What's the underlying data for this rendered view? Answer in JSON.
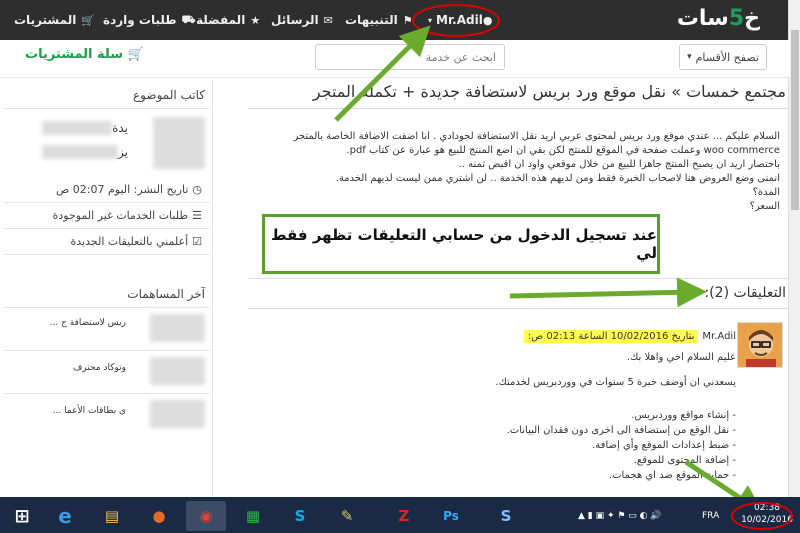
{
  "topbar": {
    "logo_text": "خ",
    "logo_num": "5",
    "logo_rest": "سات",
    "nav": [
      {
        "label": "Mr.Adil"
      },
      {
        "label": "التنبيهات"
      },
      {
        "label": "الرسائل"
      },
      {
        "label": "المفضلة"
      },
      {
        "label": "طلبات واردة"
      },
      {
        "label": "المشتريات"
      }
    ]
  },
  "subbar": {
    "browse_label": "تصفح الأقسام",
    "search_placeholder": "ابحث عن خدمة",
    "cart_label": "سلة المشتريات"
  },
  "post": {
    "title": "مجتمع خمسات » نقل موقع ورد بريس لاستضافة جديدة + تكملة المتجر",
    "lines": [
      "السلام عليكم ... عندي موقع ورد بريس لمحتوى عربي اريد نقل الاستضافة لجودادي . انا اضفت الاضافة الخاصة بالمتجر",
      "woo commerce وعملت صفحة في الموقع للمنتج لكن بقي ان اضع المنتج للبيع هو عبارة عن كتاب pdf.",
      "باختصار اريد ان يصبح المنتج جاهزا للبيع من خلال موقعي واود ان اقبض ثمنه ..",
      "انمنى وضع العروض هنا لاصحاب الخبرة فقط ومن لديهم هذه الخدمة .. لن اشتري ممن ليست لديهم الخدمة.",
      "المدة؟",
      "السعر؟"
    ]
  },
  "callout": {
    "text": "عند تسجيل الدخول من حسابي التعليقات تظهر فقط لي"
  },
  "comments": {
    "heading": "التعليقات (2):",
    "author": "Mr.Adil",
    "date": "بتاريخ 10/02/2016 الساعة 02:13 ص:",
    "lines": [
      "عليم السلام اخي واهلا بك.",
      "يسعدني ان أوضف خبرة 5 سنوات في ووردبريس لخدمتك.",
      "- إنشاء مواقع ووردبريس.",
      "- نقل الوقع من إستضافة الى اخرى دون فقدان البيانات.",
      "- ضبط إعدادات الموقع وأي إضافة.",
      "- إضافة المحتوى للموقع.",
      "- حماية الموقع ضد اي هجمات."
    ]
  },
  "sidebar": {
    "author_heading": "كاتب الموضوع",
    "author_name_partial": "يدة",
    "author_sub_partial": "يز",
    "publish_date": "تاريخ النشر: اليوم 02:07 ص",
    "missing_services": "طلبات الخدمات غير الموجودة",
    "notify_label": "أعلمني بالتعليقات الجديدة",
    "latest_heading": "آخر المساهمات",
    "latest_items": [
      "ريس لاستضافة ج ...",
      "وتوكاد محترف",
      "ي بطاقات الأعما ..."
    ]
  },
  "taskbar": {
    "lang": "FRA",
    "time": "02:38",
    "date": "10/02/2016"
  },
  "colors": {
    "topbar": "#2e2e2e",
    "accent_green": "#1a9f4b",
    "highlight_yellow": "#ffff4a",
    "annotation_red": "#dd0000",
    "annotation_green": "#5a9e2a",
    "taskbar": "#1b2a44"
  }
}
